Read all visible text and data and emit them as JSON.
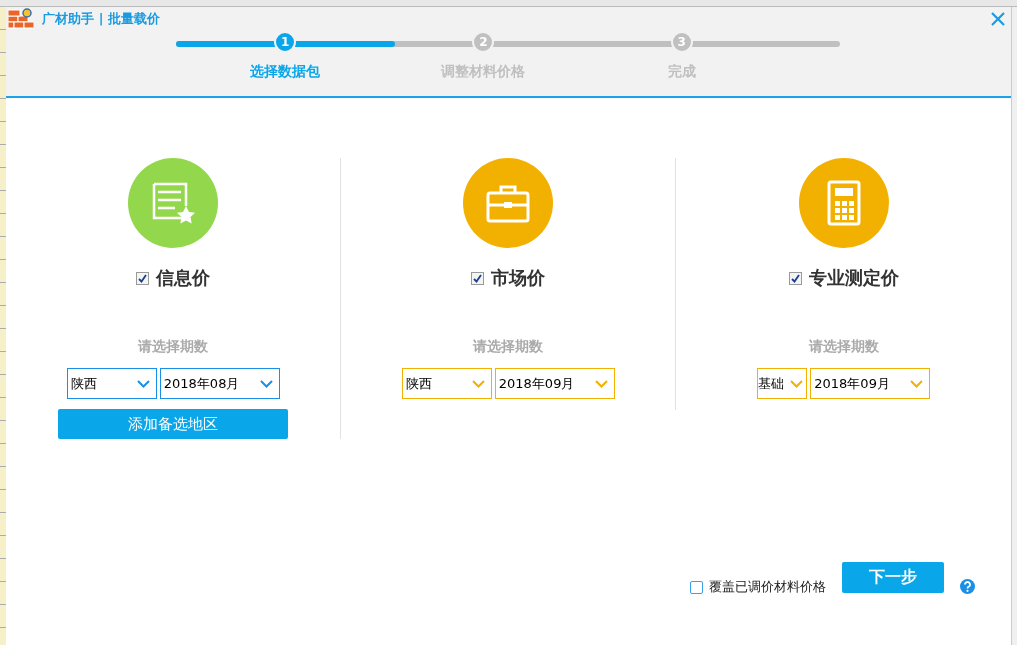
{
  "window": {
    "title": "广材助手 | 批量载价"
  },
  "steps": [
    {
      "number": "1",
      "label": "选择数据包",
      "selected": true
    },
    {
      "number": "2",
      "label": "调整材料价格",
      "selected": false
    },
    {
      "number": "3",
      "label": "完成",
      "selected": false
    }
  ],
  "progress": {
    "level": 0.33
  },
  "columns": [
    {
      "kind": "info",
      "color": "#93d84c",
      "title": "信息价",
      "checked": true,
      "period_label": "请选择期数",
      "selects": [
        {
          "kind": "region",
          "value": "陕西"
        },
        {
          "kind": "period",
          "value": "2018年08月"
        }
      ],
      "add_button": "添加备选地区"
    },
    {
      "kind": "market",
      "color": "#f2b000",
      "title": "市场价",
      "checked": true,
      "period_label": "请选择期数",
      "selects": [
        {
          "kind": "region",
          "value": "陕西"
        },
        {
          "kind": "period",
          "value": "2018年09月"
        }
      ]
    },
    {
      "kind": "professional",
      "color": "#f2b000",
      "title": "专业测定价",
      "checked": true,
      "period_label": "请选择期数",
      "selects": [
        {
          "kind": "narrow",
          "value": "基础"
        },
        {
          "kind": "period",
          "value": "2018年09月"
        }
      ]
    }
  ],
  "overwrite": {
    "label": "覆盖已调价材料价格",
    "checked": false
  },
  "next_button": "下一步"
}
